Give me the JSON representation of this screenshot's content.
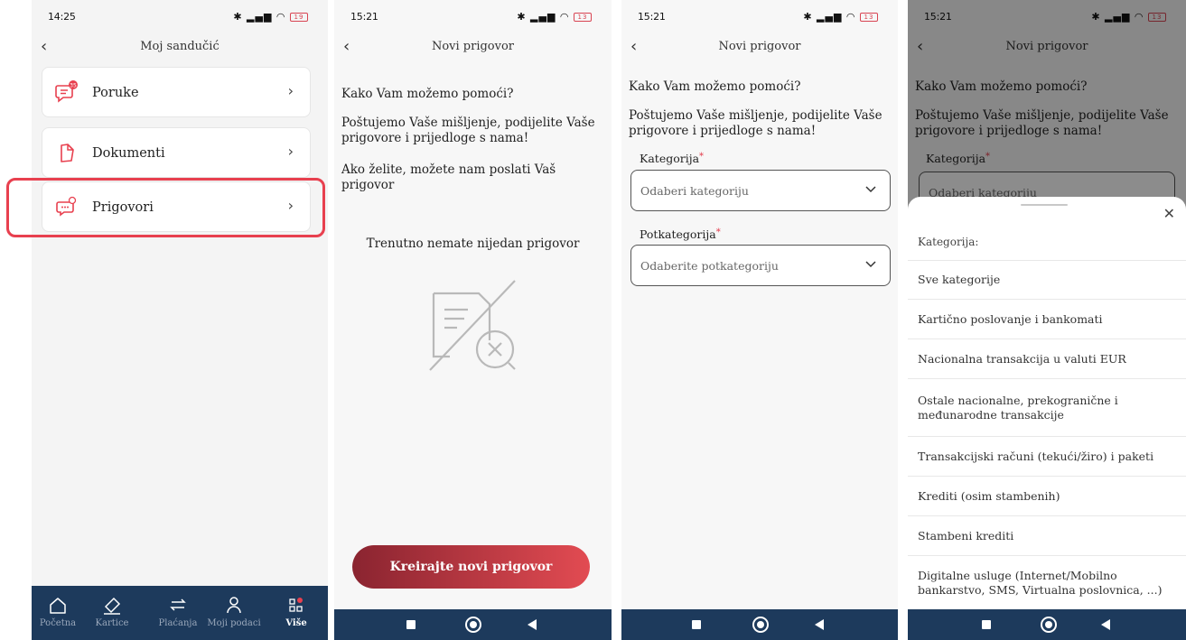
{
  "screen1": {
    "status": {
      "time": "14:25",
      "battery": "19"
    },
    "title": "Moj sandučić",
    "badge": "35",
    "items": [
      {
        "label": "Poruke"
      },
      {
        "label": "Dokumenti"
      },
      {
        "label": "Prigovori"
      }
    ],
    "nav": [
      {
        "label": "Početna"
      },
      {
        "label": "Kartice"
      },
      {
        "label": "Plaćanja"
      },
      {
        "label": "Moji podaci"
      },
      {
        "label": "Više"
      }
    ]
  },
  "screen2": {
    "status": {
      "time": "15:21",
      "battery": "13"
    },
    "title": "Novi prigovor",
    "question": "Kako Vam možemo pomoći?",
    "intro": "Poštujemo Vaše mišljenje, podijelite Vaše prigovore i prijedloge s nama!",
    "send": "Ako želite, možete nam poslati Vaš prigovor",
    "empty": "Trenutno nemate nijedan prigovor",
    "cta": "Kreirajte novi prigovor"
  },
  "screen3": {
    "status": {
      "time": "15:21",
      "battery": "13"
    },
    "title": "Novi prigovor",
    "question": "Kako Vam možemo pomoći?",
    "intro": "Poštujemo Vaše mišljenje, podijelite Vaše prigovore i prijedloge s nama!",
    "category_label": "Kategorija",
    "category_placeholder": "Odaberi kategoriju",
    "subcategory_label": "Potkategorija",
    "subcategory_placeholder": "Odaberite potkategoriju",
    "required_mark": "*"
  },
  "screen4": {
    "status": {
      "time": "15:21",
      "battery": "13"
    },
    "title": "Novi prigovor",
    "question": "Kako Vam možemo pomoći?",
    "intro": "Poštujemo Vaše mišljenje, podijelite Vaše prigovore i prijedloge s nama!",
    "category_label": "Kategorija",
    "category_placeholder": "Odaberi kategoriju",
    "sheet_title": "Kategorija:",
    "options": [
      "Sve kategorije",
      "Kartično poslovanje i bankomati",
      "Nacionalna transakcija u valuti EUR",
      "Ostale nacionalne, prekogranične i međunarodne transakcije",
      "Transakcijski računi (tekući/žiro) i paketi",
      "Krediti (osim stambenih)",
      "Stambeni krediti",
      "Digitalne usluge (Internet/Mobilno bankarstvo, SMS, Virtualna poslovnica, ...)"
    ]
  },
  "colors": {
    "accent": "#e8404f",
    "nav_bg": "#1d3a5c",
    "cta_start": "#8a2430",
    "cta_end": "#e24b52"
  }
}
